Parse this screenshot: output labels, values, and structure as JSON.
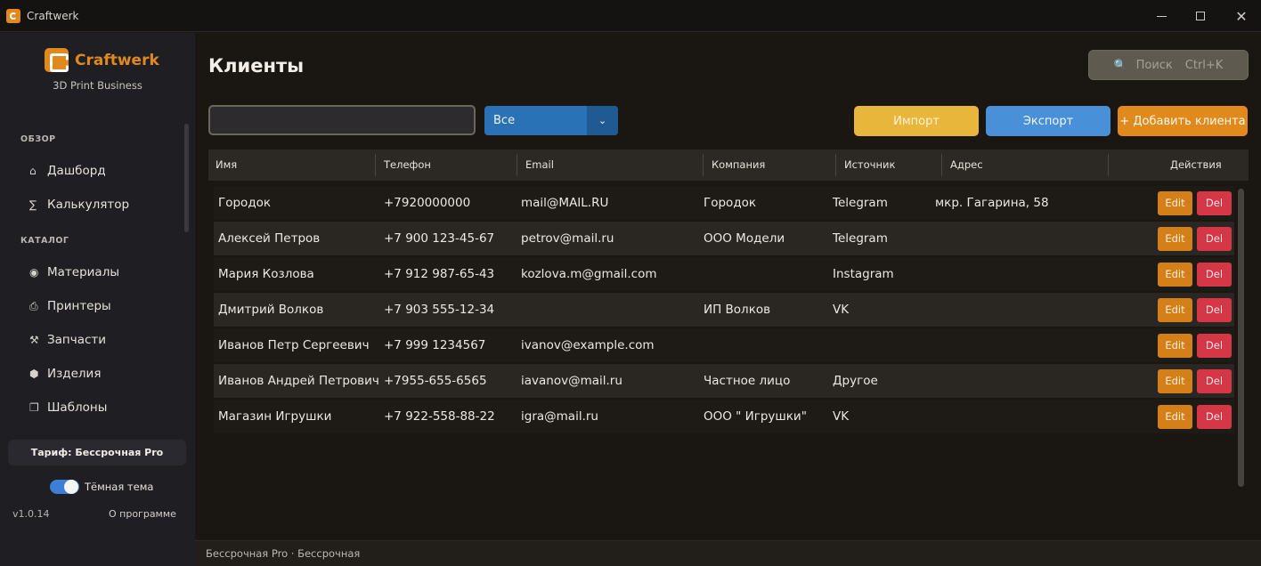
{
  "window": {
    "title": "Craftwerk",
    "minimize": "—",
    "maximize": "□",
    "close": "✕"
  },
  "sidebar": {
    "app_name": "Craftwerk",
    "app_subtitle": "3D Print Business",
    "sections": [
      {
        "title": "ОБЗОР",
        "items": [
          {
            "icon": "home-icon",
            "glyph": "⌂",
            "label": "Дашборд"
          },
          {
            "icon": "sigma-icon",
            "glyph": "∑",
            "label": "Калькулятор"
          }
        ]
      },
      {
        "title": "КАТАЛОГ",
        "items": [
          {
            "icon": "spool-icon",
            "glyph": "◉",
            "label": "Материалы"
          },
          {
            "icon": "printer-icon",
            "glyph": "⎙",
            "label": "Принтеры"
          },
          {
            "icon": "tools-icon",
            "glyph": "⚒",
            "label": "Запчасти"
          },
          {
            "icon": "hexagon-icon",
            "glyph": "⬢",
            "label": "Изделия"
          },
          {
            "icon": "copy-icon",
            "glyph": "❐",
            "label": "Шаблоны"
          }
        ]
      }
    ],
    "tariff": "Тариф: Бессрочная Pro",
    "theme_label": "Тёмная тема",
    "theme_dark_enabled": true,
    "version": "v1.0.14",
    "about": "О программе"
  },
  "main": {
    "title": "Клиенты",
    "search": {
      "icon": "search-icon",
      "label": "Поиск",
      "shortcut": "Ctrl+K"
    },
    "filter_input": {
      "value": "",
      "placeholder": ""
    },
    "source_filter": {
      "value": "Все",
      "arrow": "⌄"
    },
    "buttons": {
      "import": "Импорт",
      "export": "Экспорт",
      "add": "+ Добавить клиента"
    },
    "table": {
      "columns": [
        "Имя",
        "Телефон",
        "Email",
        "Компания",
        "Источник",
        "Адрес",
        "Действия"
      ],
      "row_actions": {
        "edit": "Edit",
        "delete": "Del"
      },
      "rows": [
        {
          "name": "Городок",
          "phone": "+7920000000",
          "email": "mail@MAIL.RU",
          "company": "Городок",
          "source": "Telegram",
          "address": "мкр. Гагарина, 58"
        },
        {
          "name": "Алексей Петров",
          "phone": "+7 900 123-45-67",
          "email": "petrov@mail.ru",
          "company": "ООО Модели",
          "source": "Telegram",
          "address": ""
        },
        {
          "name": "Мария Козлова",
          "phone": "+7 912 987-65-43",
          "email": "kozlova.m@gmail.com",
          "company": "",
          "source": "Instagram",
          "address": ""
        },
        {
          "name": "Дмитрий Волков",
          "phone": "+7 903 555-12-34",
          "email": "",
          "company": "ИП Волков",
          "source": "VK",
          "address": ""
        },
        {
          "name": "Иванов Петр Сергеевич",
          "phone": "+7 999 1234567",
          "email": "ivanov@example.com",
          "company": "",
          "source": "",
          "address": ""
        },
        {
          "name": "Иванов Андрей Петрович",
          "phone": "+7955-655-6565",
          "email": "iavanov@mail.ru",
          "company": "Частное лицо",
          "source": "Другое",
          "address": ""
        },
        {
          "name": "Магазин Игрушки",
          "phone": "+7 922-558-88-22",
          "email": "igra@mail.ru",
          "company": "ООО \" Игрушки\"",
          "source": "VK",
          "address": ""
        }
      ]
    }
  },
  "statusbar": {
    "text": "Бессрочная Pro · Бессрочная"
  },
  "colors": {
    "accent": "#e08a1e",
    "import": "#e8b63a",
    "export": "#4a90d9",
    "delete": "#d63747",
    "select": "#2a72b5"
  }
}
